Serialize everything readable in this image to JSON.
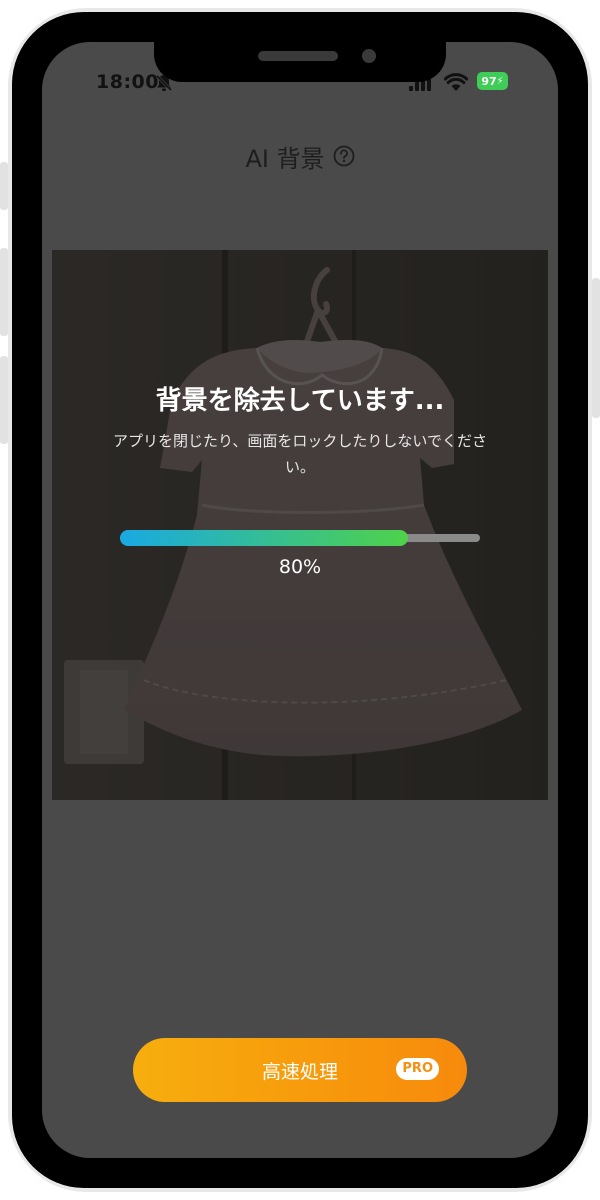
{
  "status": {
    "time": "18:00",
    "battery": "97"
  },
  "header": {
    "title": "AI 背景"
  },
  "processing": {
    "title": "背景を除去しています...",
    "message": "アプリを閉じたり、画面をロックしたりしないでください。",
    "progress": 0.8,
    "progress_label": "80%"
  },
  "cta": {
    "label": "高速処理",
    "badge": "PRO"
  },
  "icons": {
    "bell": "bell-slash-icon",
    "signal": "cellular-signal-icon",
    "wifi": "wifi-icon",
    "help": "question-circle-icon"
  },
  "colors": {
    "progress_start": "#19a9e2",
    "progress_end": "#4fd24a",
    "cta_start": "#f7ae0d",
    "cta_end": "#f78a0c",
    "battery": "#3fcd58"
  }
}
